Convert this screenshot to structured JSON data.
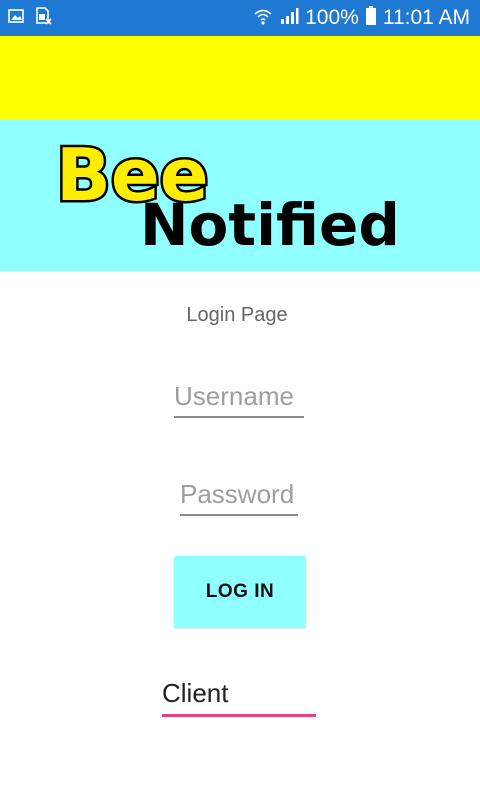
{
  "status_bar": {
    "battery_percent": "100%",
    "time": "11:01 AM",
    "icons": [
      "gallery-icon",
      "sim-card-icon",
      "wifi-icon",
      "signal-icon",
      "battery-icon"
    ],
    "background": "#1f78d1"
  },
  "header": {
    "yellow_bar_color": "#ffff00",
    "banner_color": "#8fffff",
    "logo": {
      "line1": "Bee",
      "line2": "Notified"
    }
  },
  "login": {
    "title": "Login Page",
    "username_placeholder": "Username",
    "password_placeholder": "Password",
    "button_label": "LOG IN",
    "button_color": "#8fffff",
    "role_selected": "Client",
    "role_underline_color": "#e8407a"
  }
}
